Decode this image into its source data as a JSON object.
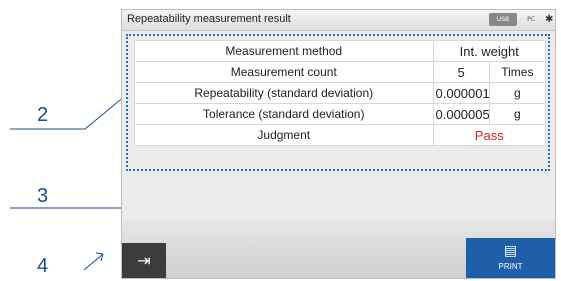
{
  "screen": {
    "title": "Repeatability measurement result",
    "status_usb": "USB",
    "status_pc": "PC",
    "status_bt": "✱"
  },
  "results": {
    "rows": [
      {
        "label": "Measurement method",
        "value": "Int. weight",
        "unit": ""
      },
      {
        "label": "Measurement count",
        "value": "5",
        "unit": "Times"
      },
      {
        "label": "Repeatability (standard deviation)",
        "value": "0.0000010",
        "unit": "g"
      },
      {
        "label": "Tolerance (standard deviation)",
        "value": "0.0000050",
        "unit": "g"
      },
      {
        "label": "Judgment",
        "value": "Pass",
        "unit": ""
      }
    ],
    "pass_color": "#e02020"
  },
  "buttons": {
    "exit_icon": "exit-icon",
    "exit_glyph": "⇥",
    "print_icon": "print-icon",
    "print_glyph": "▤",
    "print_label": "PRINT"
  },
  "callouts": {
    "c2": "2",
    "c3": "3",
    "c4": "4"
  },
  "colors": {
    "accent": "#1f5ea8",
    "callout": "#1a4f8a",
    "dotted": "#1e73c8"
  }
}
